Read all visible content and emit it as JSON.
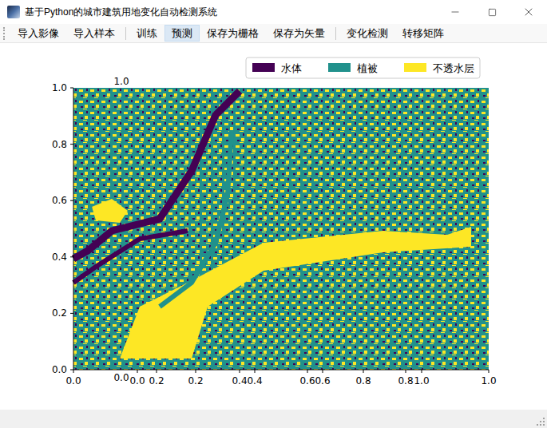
{
  "window": {
    "title": "基于Python的城市建筑用地变化自动检测系统"
  },
  "toolbar": {
    "groups": [
      [
        {
          "label": "导入影像",
          "selected": false
        },
        {
          "label": "导入样本",
          "selected": false
        }
      ],
      [
        {
          "label": "训练",
          "selected": false
        },
        {
          "label": "预测",
          "selected": true
        },
        {
          "label": "保存为栅格",
          "selected": false
        },
        {
          "label": "保存为矢量",
          "selected": false
        }
      ],
      [
        {
          "label": "变化检测",
          "selected": false
        },
        {
          "label": "转移矩阵",
          "selected": false
        }
      ]
    ]
  },
  "chart": {
    "legend": [
      {
        "label": "水体",
        "color": "#440154"
      },
      {
        "label": "植被",
        "color": "#21918c"
      },
      {
        "label": "不透水层",
        "color": "#fde725"
      }
    ],
    "primary_axis": {
      "x_ticks": [
        "0.0",
        "0.2",
        "0.4",
        "0.6",
        "0.8",
        "1.0"
      ],
      "y_ticks": [
        "0.0",
        "0.2",
        "0.4",
        "0.6",
        "0.8",
        "1.0"
      ]
    },
    "secondary_axis": {
      "x_ticks": [
        "0.0",
        "0.2",
        "0.4",
        "0.6",
        "0.8",
        "1.0"
      ],
      "y_ticks": [
        "0.0",
        "1.0"
      ]
    }
  }
}
